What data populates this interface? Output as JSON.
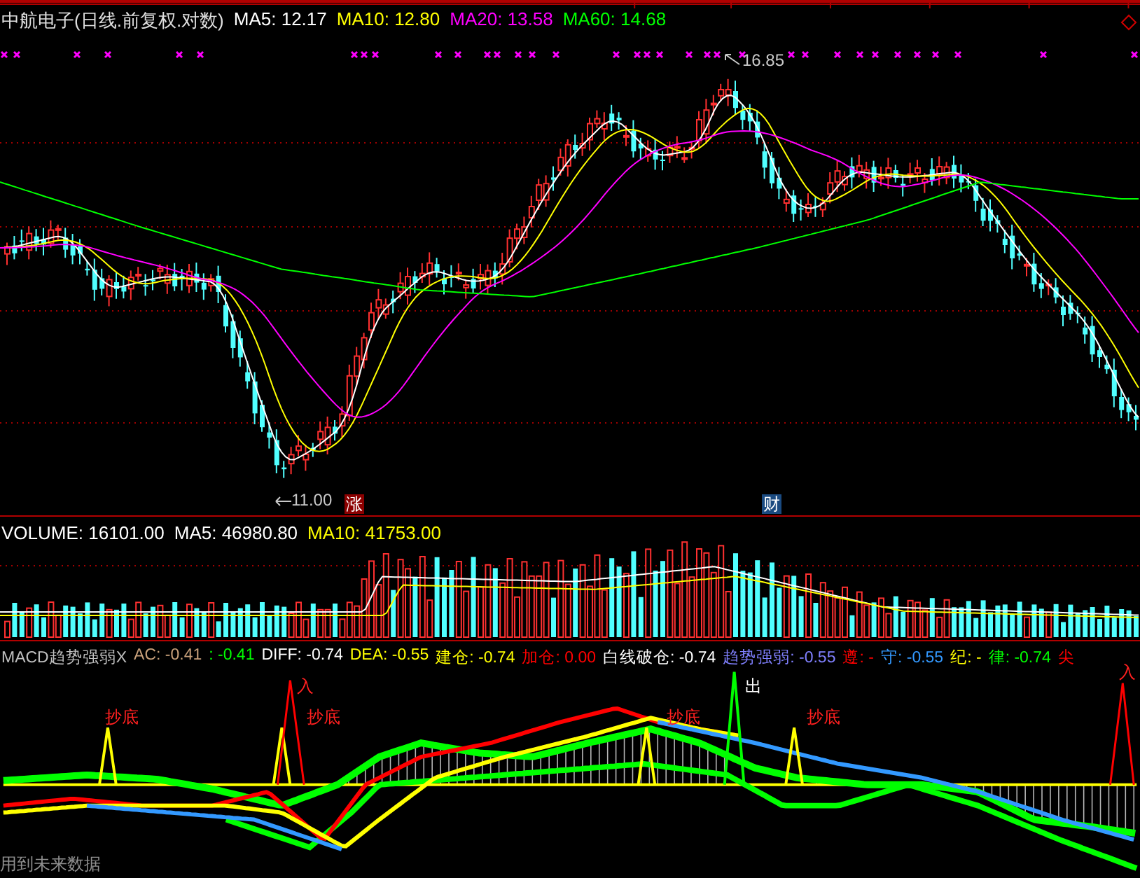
{
  "price_panel": {
    "title": "中航电子(日线.前复权.对数)",
    "legend": [
      {
        "label": "MA5: 12.17",
        "color": "#ffffff"
      },
      {
        "label": "MA10: 12.80",
        "color": "#ffff00"
      },
      {
        "label": "MA20: 13.58",
        "color": "#ff00ff"
      },
      {
        "label": "MA60: 14.68",
        "color": "#00ff00"
      }
    ],
    "high_label": "16.85",
    "low_label": "11.00",
    "markers": [
      {
        "text": "涨",
        "kind": "rise"
      },
      {
        "text": "财",
        "kind": "finance"
      }
    ]
  },
  "volume_panel": {
    "legend": [
      {
        "label": "VOLUME: 16101.00",
        "color": "#ffffff"
      },
      {
        "label": "MA5: 46980.80",
        "color": "#ffffff"
      },
      {
        "label": "MA10: 41753.00",
        "color": "#ffff00"
      }
    ]
  },
  "macd_panel": {
    "legend": [
      {
        "label": "MACD趋势强弱X",
        "color": "#c0c0c0"
      },
      {
        "label": "AC: -0.41",
        "color": "#c8a07a"
      },
      {
        "label": ": -0.41",
        "color": "#00ff00"
      },
      {
        "label": "DIFF: -0.74",
        "color": "#ffffff"
      },
      {
        "label": "DEA: -0.55",
        "color": "#ffff00"
      },
      {
        "label": "建仓: -0.74",
        "color": "#ffff00"
      },
      {
        "label": "加仓: 0.00",
        "color": "#ff0000"
      },
      {
        "label": "白线破仓: -0.74",
        "color": "#ffffff"
      },
      {
        "label": "趋势强弱: -0.55",
        "color": "#8080ff"
      },
      {
        "label": "遵: -",
        "color": "#ff0000"
      },
      {
        "label": "守: -0.55",
        "color": "#3399ff"
      },
      {
        "label": "纪: -",
        "color": "#ffff00"
      },
      {
        "label": "律: -0.74",
        "color": "#00ff00"
      },
      {
        "label": "尖",
        "color": "#ff0000"
      }
    ],
    "annotations": [
      {
        "text": "抄底",
        "kind": "bottom"
      },
      {
        "text": "入",
        "kind": "entry"
      },
      {
        "text": "抄底",
        "kind": "bottom"
      },
      {
        "text": "抄底",
        "kind": "bottom"
      },
      {
        "text": "出",
        "kind": "exit"
      },
      {
        "text": "抄底",
        "kind": "bottom"
      },
      {
        "text": "入",
        "kind": "entry"
      }
    ],
    "footnote": "用到未来数据"
  }
}
